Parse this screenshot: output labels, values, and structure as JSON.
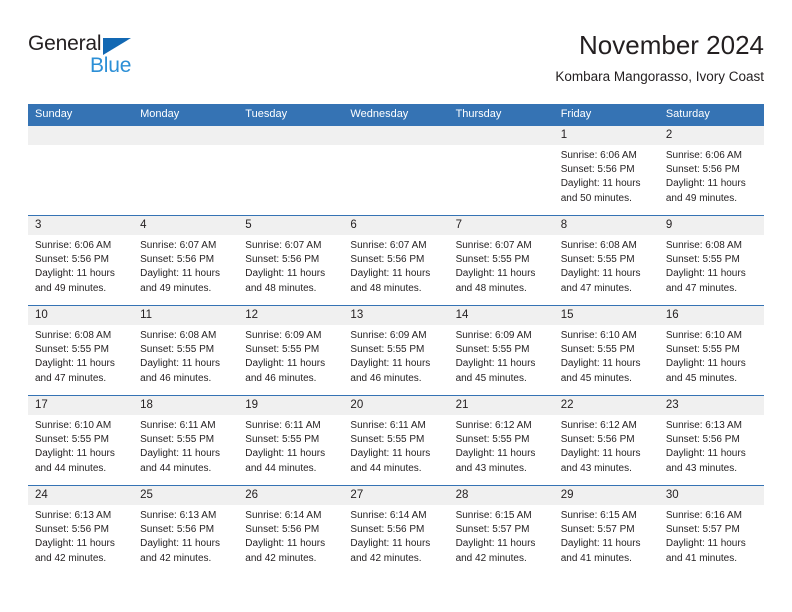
{
  "logo": {
    "word1": "General",
    "word2": "Blue",
    "triangle_color": "#1268b3",
    "word2_color": "#2c8fd6"
  },
  "header": {
    "title": "November 2024",
    "subtitle": "Kombara Mangorasso, Ivory Coast"
  },
  "theme": {
    "header_blue": "#3573b4",
    "row_divider_blue": "#3573b4",
    "daynum_band": "#f0f0f0"
  },
  "calendar": {
    "weekday_headers": [
      "Sunday",
      "Monday",
      "Tuesday",
      "Wednesday",
      "Thursday",
      "Friday",
      "Saturday"
    ],
    "weeks": [
      [
        {
          "day": "",
          "empty": true
        },
        {
          "day": "",
          "empty": true
        },
        {
          "day": "",
          "empty": true
        },
        {
          "day": "",
          "empty": true
        },
        {
          "day": "",
          "empty": true
        },
        {
          "day": "1",
          "sunrise": "Sunrise: 6:06 AM",
          "sunset": "Sunset: 5:56 PM",
          "daylight1": "Daylight: 11 hours",
          "daylight2": "and 50 minutes."
        },
        {
          "day": "2",
          "sunrise": "Sunrise: 6:06 AM",
          "sunset": "Sunset: 5:56 PM",
          "daylight1": "Daylight: 11 hours",
          "daylight2": "and 49 minutes."
        }
      ],
      [
        {
          "day": "3",
          "sunrise": "Sunrise: 6:06 AM",
          "sunset": "Sunset: 5:56 PM",
          "daylight1": "Daylight: 11 hours",
          "daylight2": "and 49 minutes."
        },
        {
          "day": "4",
          "sunrise": "Sunrise: 6:07 AM",
          "sunset": "Sunset: 5:56 PM",
          "daylight1": "Daylight: 11 hours",
          "daylight2": "and 49 minutes."
        },
        {
          "day": "5",
          "sunrise": "Sunrise: 6:07 AM",
          "sunset": "Sunset: 5:56 PM",
          "daylight1": "Daylight: 11 hours",
          "daylight2": "and 48 minutes."
        },
        {
          "day": "6",
          "sunrise": "Sunrise: 6:07 AM",
          "sunset": "Sunset: 5:56 PM",
          "daylight1": "Daylight: 11 hours",
          "daylight2": "and 48 minutes."
        },
        {
          "day": "7",
          "sunrise": "Sunrise: 6:07 AM",
          "sunset": "Sunset: 5:55 PM",
          "daylight1": "Daylight: 11 hours",
          "daylight2": "and 48 minutes."
        },
        {
          "day": "8",
          "sunrise": "Sunrise: 6:08 AM",
          "sunset": "Sunset: 5:55 PM",
          "daylight1": "Daylight: 11 hours",
          "daylight2": "and 47 minutes."
        },
        {
          "day": "9",
          "sunrise": "Sunrise: 6:08 AM",
          "sunset": "Sunset: 5:55 PM",
          "daylight1": "Daylight: 11 hours",
          "daylight2": "and 47 minutes."
        }
      ],
      [
        {
          "day": "10",
          "sunrise": "Sunrise: 6:08 AM",
          "sunset": "Sunset: 5:55 PM",
          "daylight1": "Daylight: 11 hours",
          "daylight2": "and 47 minutes."
        },
        {
          "day": "11",
          "sunrise": "Sunrise: 6:08 AM",
          "sunset": "Sunset: 5:55 PM",
          "daylight1": "Daylight: 11 hours",
          "daylight2": "and 46 minutes."
        },
        {
          "day": "12",
          "sunrise": "Sunrise: 6:09 AM",
          "sunset": "Sunset: 5:55 PM",
          "daylight1": "Daylight: 11 hours",
          "daylight2": "and 46 minutes."
        },
        {
          "day": "13",
          "sunrise": "Sunrise: 6:09 AM",
          "sunset": "Sunset: 5:55 PM",
          "daylight1": "Daylight: 11 hours",
          "daylight2": "and 46 minutes."
        },
        {
          "day": "14",
          "sunrise": "Sunrise: 6:09 AM",
          "sunset": "Sunset: 5:55 PM",
          "daylight1": "Daylight: 11 hours",
          "daylight2": "and 45 minutes."
        },
        {
          "day": "15",
          "sunrise": "Sunrise: 6:10 AM",
          "sunset": "Sunset: 5:55 PM",
          "daylight1": "Daylight: 11 hours",
          "daylight2": "and 45 minutes."
        },
        {
          "day": "16",
          "sunrise": "Sunrise: 6:10 AM",
          "sunset": "Sunset: 5:55 PM",
          "daylight1": "Daylight: 11 hours",
          "daylight2": "and 45 minutes."
        }
      ],
      [
        {
          "day": "17",
          "sunrise": "Sunrise: 6:10 AM",
          "sunset": "Sunset: 5:55 PM",
          "daylight1": "Daylight: 11 hours",
          "daylight2": "and 44 minutes."
        },
        {
          "day": "18",
          "sunrise": "Sunrise: 6:11 AM",
          "sunset": "Sunset: 5:55 PM",
          "daylight1": "Daylight: 11 hours",
          "daylight2": "and 44 minutes."
        },
        {
          "day": "19",
          "sunrise": "Sunrise: 6:11 AM",
          "sunset": "Sunset: 5:55 PM",
          "daylight1": "Daylight: 11 hours",
          "daylight2": "and 44 minutes."
        },
        {
          "day": "20",
          "sunrise": "Sunrise: 6:11 AM",
          "sunset": "Sunset: 5:55 PM",
          "daylight1": "Daylight: 11 hours",
          "daylight2": "and 44 minutes."
        },
        {
          "day": "21",
          "sunrise": "Sunrise: 6:12 AM",
          "sunset": "Sunset: 5:55 PM",
          "daylight1": "Daylight: 11 hours",
          "daylight2": "and 43 minutes."
        },
        {
          "day": "22",
          "sunrise": "Sunrise: 6:12 AM",
          "sunset": "Sunset: 5:56 PM",
          "daylight1": "Daylight: 11 hours",
          "daylight2": "and 43 minutes."
        },
        {
          "day": "23",
          "sunrise": "Sunrise: 6:13 AM",
          "sunset": "Sunset: 5:56 PM",
          "daylight1": "Daylight: 11 hours",
          "daylight2": "and 43 minutes."
        }
      ],
      [
        {
          "day": "24",
          "sunrise": "Sunrise: 6:13 AM",
          "sunset": "Sunset: 5:56 PM",
          "daylight1": "Daylight: 11 hours",
          "daylight2": "and 42 minutes."
        },
        {
          "day": "25",
          "sunrise": "Sunrise: 6:13 AM",
          "sunset": "Sunset: 5:56 PM",
          "daylight1": "Daylight: 11 hours",
          "daylight2": "and 42 minutes."
        },
        {
          "day": "26",
          "sunrise": "Sunrise: 6:14 AM",
          "sunset": "Sunset: 5:56 PM",
          "daylight1": "Daylight: 11 hours",
          "daylight2": "and 42 minutes."
        },
        {
          "day": "27",
          "sunrise": "Sunrise: 6:14 AM",
          "sunset": "Sunset: 5:56 PM",
          "daylight1": "Daylight: 11 hours",
          "daylight2": "and 42 minutes."
        },
        {
          "day": "28",
          "sunrise": "Sunrise: 6:15 AM",
          "sunset": "Sunset: 5:57 PM",
          "daylight1": "Daylight: 11 hours",
          "daylight2": "and 42 minutes."
        },
        {
          "day": "29",
          "sunrise": "Sunrise: 6:15 AM",
          "sunset": "Sunset: 5:57 PM",
          "daylight1": "Daylight: 11 hours",
          "daylight2": "and 41 minutes."
        },
        {
          "day": "30",
          "sunrise": "Sunrise: 6:16 AM",
          "sunset": "Sunset: 5:57 PM",
          "daylight1": "Daylight: 11 hours",
          "daylight2": "and 41 minutes."
        }
      ]
    ]
  }
}
